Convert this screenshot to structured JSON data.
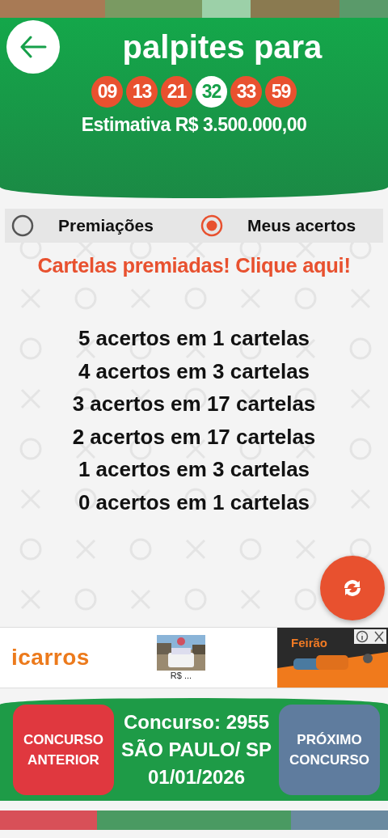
{
  "header": {
    "title": "palpites para",
    "numbers": [
      {
        "value": "09",
        "selected": false
      },
      {
        "value": "13",
        "selected": false
      },
      {
        "value": "21",
        "selected": false
      },
      {
        "value": "32",
        "selected": true
      },
      {
        "value": "33",
        "selected": false
      },
      {
        "value": "59",
        "selected": false
      }
    ],
    "estimate": "Estimativa R$ 3.500.000,00"
  },
  "view_options": [
    {
      "label": "Premiações",
      "selected": false
    },
    {
      "label": "Meus acertos",
      "selected": true
    }
  ],
  "prize_link": "Cartelas premiadas! Clique aqui!",
  "results": [
    "5 acertos em 1 cartelas",
    "4 acertos em 3 cartelas",
    "3 acertos em 17 cartelas",
    "2 acertos em 17 cartelas",
    "1 acertos em 3 cartelas",
    "0 acertos em 1 cartelas"
  ],
  "ad": {
    "brand": "icarros",
    "listing_price": "R$ ...",
    "banner_title": "Feirão"
  },
  "footer": {
    "previous_button": "CONCURSO ANTERIOR",
    "contest": "Concurso: 2955",
    "location": "SÃO PAULO/ SP",
    "date": "01/01/2026",
    "next_button": "PRÓXIMO CONCURSO"
  }
}
